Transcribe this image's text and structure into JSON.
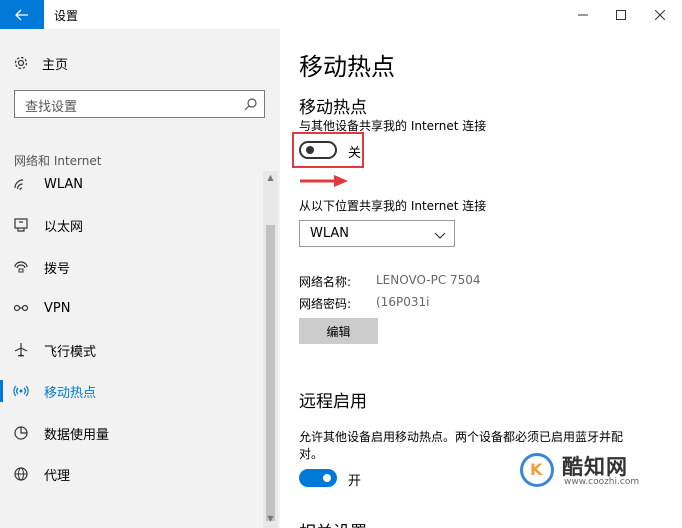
{
  "window": {
    "title": "设置",
    "minimize_glyph": "—",
    "maximize_glyph": "☐",
    "close_glyph": "✕"
  },
  "sidebar": {
    "home_label": "主页",
    "search_placeholder": "查找设置",
    "group_label": "网络和 Internet",
    "items": [
      {
        "label": "WLAN",
        "icon": "wifi-icon"
      },
      {
        "label": "以太网",
        "icon": "ethernet-icon"
      },
      {
        "label": "拨号",
        "icon": "dialup-icon"
      },
      {
        "label": "VPN",
        "icon": "vpn-icon"
      },
      {
        "label": "飞行模式",
        "icon": "airplane-icon"
      },
      {
        "label": "移动热点",
        "icon": "hotspot-icon",
        "active": true
      },
      {
        "label": "数据使用量",
        "icon": "data-usage-icon"
      },
      {
        "label": "代理",
        "icon": "globe-icon"
      }
    ]
  },
  "main": {
    "page_title": "移动热点",
    "hotspot": {
      "section_title": "移动热点",
      "share_desc": "与其他设备共享我的 Internet 连接",
      "toggle_state": "关",
      "share_from_label": "从以下位置共享我的 Internet 连接",
      "share_from_value": "WLAN",
      "network_name_label": "网络名称:",
      "network_name_value": "LENOVO-PC 7504",
      "network_password_label": "网络密码:",
      "network_password_value": "(16P031i",
      "edit_button": "编辑"
    },
    "remote": {
      "section_title": "远程启用",
      "desc_line1": "允许其他设备启用移动热点。两个设备都必须已启用蓝牙并配",
      "desc_line2": "对。",
      "toggle_state": "开"
    },
    "related_partial": "相关设置"
  },
  "watermark": {
    "title": "酷知网",
    "url": "www.coozhi.com"
  },
  "colors": {
    "accent": "#0078d7",
    "sidebar_bg": "#f2f2f2",
    "highlight_red": "#e0393e"
  }
}
